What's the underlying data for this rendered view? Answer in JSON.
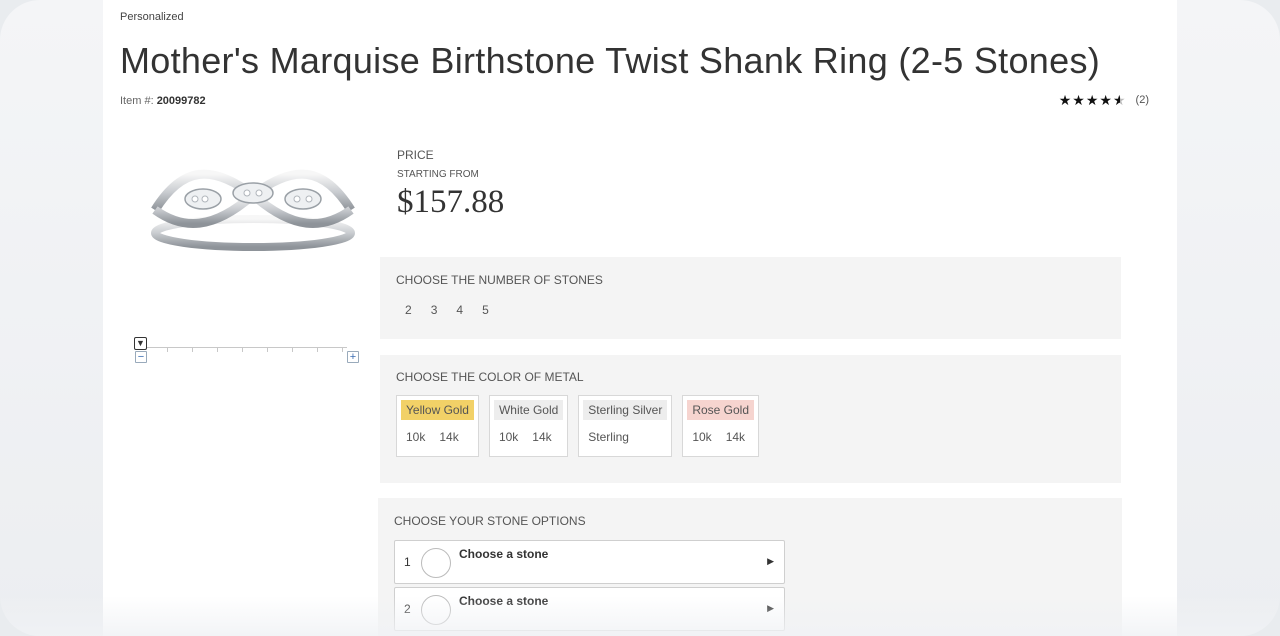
{
  "breadcrumb": "Personalized",
  "title": "Mother's Marquise Birthstone Twist Shank Ring (2-5 Stones)",
  "item": {
    "label": "Item #:",
    "number": "20099782"
  },
  "rating": {
    "stars": 4.5,
    "count": "(2)"
  },
  "price": {
    "label": "PRICE",
    "sub": "STARTING FROM",
    "value": "$157.88"
  },
  "stones_count": {
    "title": "CHOOSE THE NUMBER OF STONES",
    "options": [
      "2",
      "3",
      "4",
      "5"
    ]
  },
  "metal": {
    "title": "CHOOSE THE COLOR OF METAL",
    "options": [
      {
        "name": "Yellow Gold",
        "color": "#f2d167",
        "karats": [
          "10k",
          "14k"
        ]
      },
      {
        "name": "White Gold",
        "color": "#ededed",
        "karats": [
          "10k",
          "14k"
        ]
      },
      {
        "name": "Sterling Silver",
        "color": "#ededed",
        "karats": [
          "Sterling"
        ]
      },
      {
        "name": "Rose Gold",
        "color": "#f6d4cf",
        "karats": [
          "10k",
          "14k"
        ]
      }
    ]
  },
  "stone_options": {
    "title": "CHOOSE YOUR STONE OPTIONS",
    "rows": [
      {
        "num": "1",
        "label": "Choose a stone"
      },
      {
        "num": "2",
        "label": "Choose a stone"
      }
    ]
  }
}
